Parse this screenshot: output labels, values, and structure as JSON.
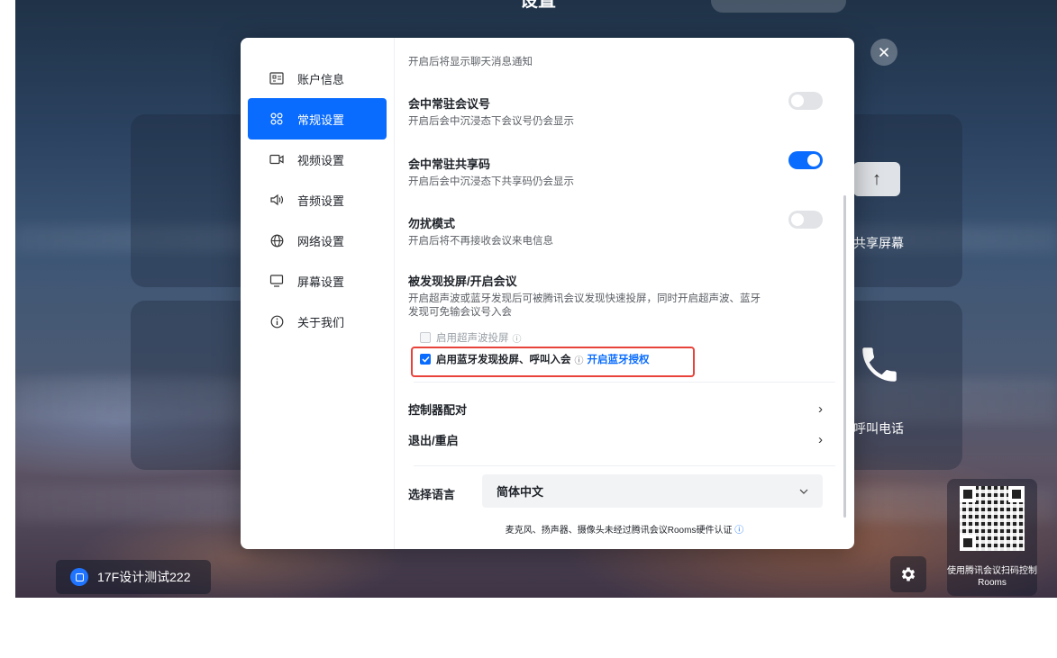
{
  "background": {
    "title": "设置",
    "room_name": "17F设计测试222",
    "share_label": "共享屏幕",
    "call_label": "呼叫电话",
    "qr_caption": "使用腾讯会议扫码控制 Rooms"
  },
  "sidebar": {
    "items": [
      {
        "label": "账户信息",
        "icon": "account-card-icon"
      },
      {
        "label": "常规设置",
        "icon": "general-grid-icon"
      },
      {
        "label": "视频设置",
        "icon": "video-icon"
      },
      {
        "label": "音频设置",
        "icon": "speaker-icon"
      },
      {
        "label": "网络设置",
        "icon": "globe-icon"
      },
      {
        "label": "屏幕设置",
        "icon": "monitor-icon"
      },
      {
        "label": "关于我们",
        "icon": "info-icon"
      }
    ],
    "active_index": 1
  },
  "settings": {
    "top_desc": "开启后将显示聊天消息通知",
    "meeting_id": {
      "title": "会中常驻会议号",
      "desc": "开启后会中沉浸态下会议号仍会显示",
      "enabled": false
    },
    "share_code": {
      "title": "会中常驻共享码",
      "desc": "开启后会中沉浸态下共享码仍会显示",
      "enabled": true
    },
    "dnd": {
      "title": "勿扰模式",
      "desc": "开启后将不再接收会议来电信息",
      "enabled": false
    },
    "discover": {
      "title": "被发现投屏/开启会议",
      "desc_line1": "开启超声波或蓝牙发现后可被腾讯会议发现快速投屏，同时开启超声波、蓝牙",
      "desc_line2": "发现可免输会议号入会",
      "ultrasonic_label": "启用超声波投屏",
      "ultrasonic_checked": false,
      "bluetooth_label": "启用蓝牙发现投屏、呼叫入会",
      "bluetooth_checked": true,
      "bluetooth_link": "开启蓝牙授权"
    },
    "controller_pair": "控制器配对",
    "exit_restart": "退出/重启",
    "language_label": "选择语言",
    "language_value": "简体中文",
    "footer_note": "麦克风、扬声器、摄像头未经过腾讯会议Rooms硬件认证"
  },
  "colors": {
    "accent": "#0a6cff",
    "highlight": "#e8433b"
  }
}
